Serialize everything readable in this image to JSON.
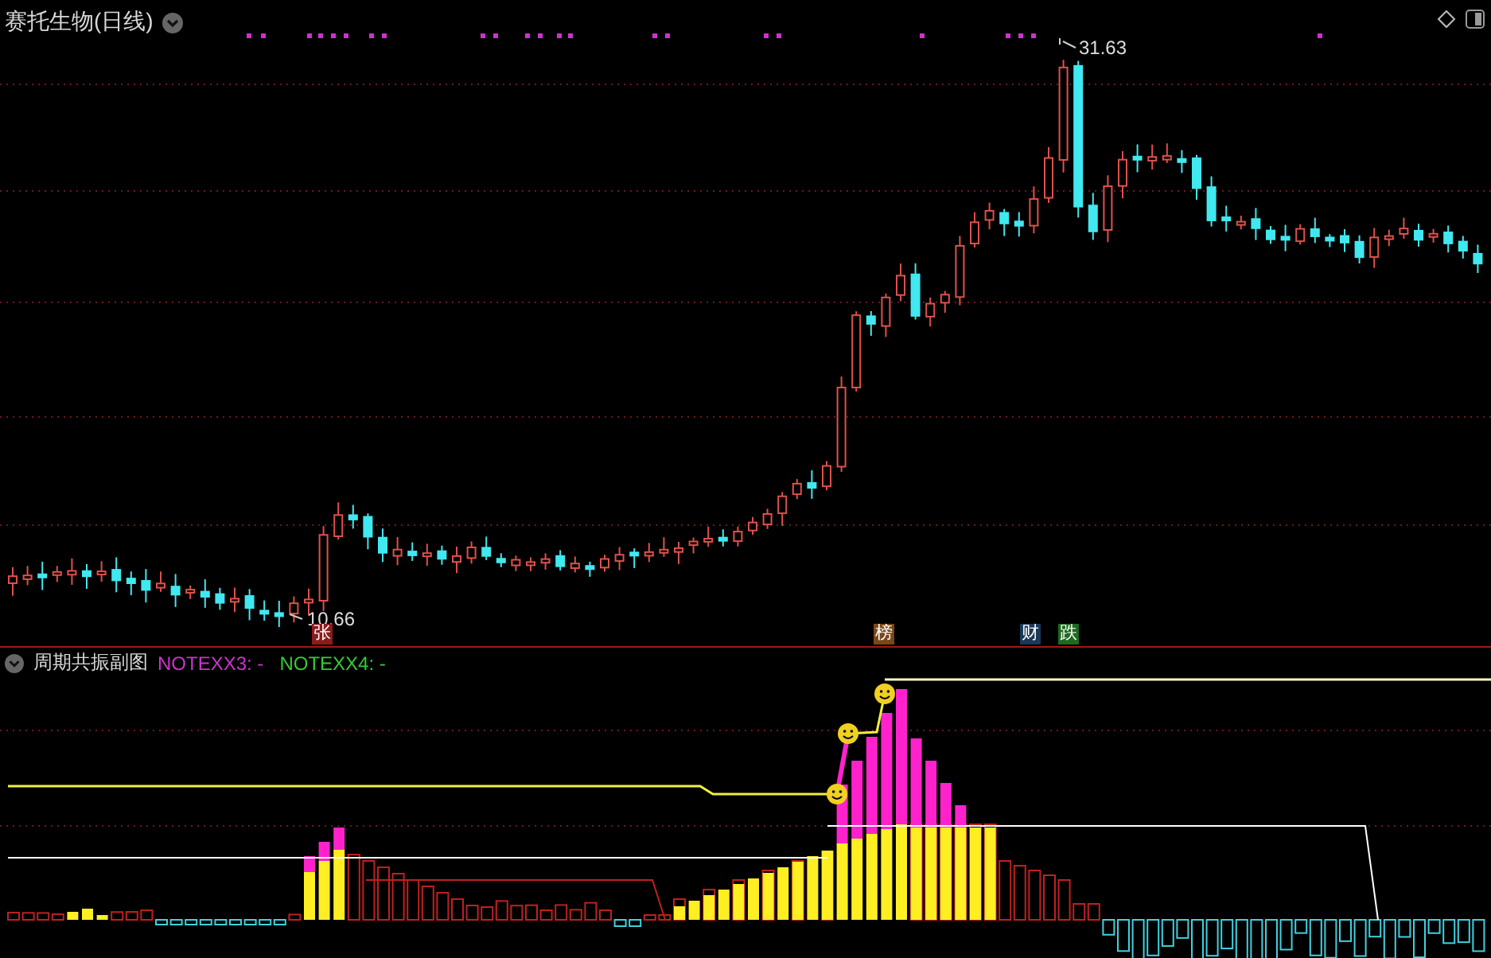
{
  "chart": {
    "title": "赛托生物(日线)",
    "high_label": "31.63",
    "low_label": "10.66",
    "signal_tags": [
      {
        "text": "张",
        "color": "#8c1c1c"
      },
      {
        "text": "榜",
        "color": "#7a4818"
      },
      {
        "text": "财",
        "color": "#1a3858"
      },
      {
        "text": "跌",
        "color": "#1e6a1e"
      }
    ]
  },
  "indicator": {
    "title": "周期共振副图",
    "legend": [
      {
        "text": "NOTEXX3: -",
        "color": "#cc33cc"
      },
      {
        "text": "NOTEXX4: -",
        "color": "#33cc33"
      }
    ]
  }
}
